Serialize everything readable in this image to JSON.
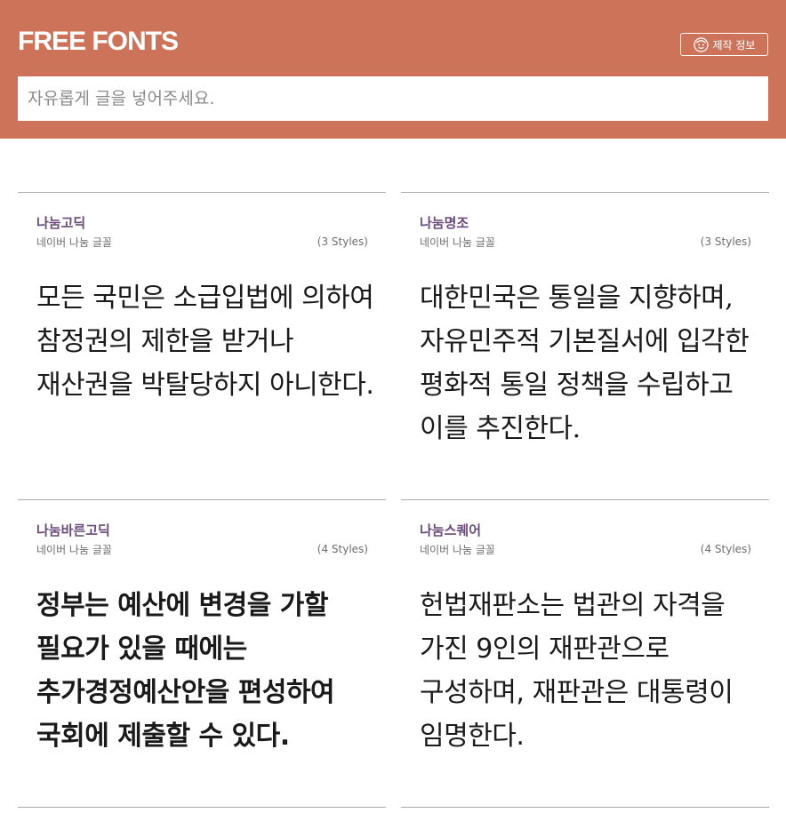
{
  "header": {
    "logo": "FREE FONTS",
    "credits_label": "제작 정보",
    "credits_icon": "smile-icon",
    "bg_color": "#cd735a"
  },
  "search": {
    "placeholder": "자유롭게 글을 넣어주세요.",
    "value": ""
  },
  "cards": [
    {
      "name": "나눔고딕",
      "subtitle": "네이버 나눔 글꼴",
      "styles": "(3 Styles)",
      "sample": "모든 국민은 소급입법에 의하여 참정권의 제한을 받거나 재산권을 박탈당하지 아니한다."
    },
    {
      "name": "나눔명조",
      "subtitle": "네이버 나눔 글꼴",
      "styles": "(3 Styles)",
      "sample": "대한민국은 통일을 지향하며, 자유민주적 기본질서에 입각한 평화적 통일 정책을 수립하고 이를 추진한다."
    },
    {
      "name": "나눔바른고딕",
      "subtitle": "네이버 나눔 글꼴",
      "styles": "(4 Styles)",
      "sample": "정부는 예산에 변경을 가할 필요가 있을 때에는 추가경정예산안을 편성하여 국회에 제출할 수 있다."
    },
    {
      "name": "나눔스퀘어",
      "subtitle": "네이버 나눔 글꼴",
      "styles": "(4 Styles)",
      "sample": "헌법재판소는 법관의 자격을 가진 9인의 재판관으로 구성하며, 재판관은 대통령이 임명한다."
    }
  ]
}
